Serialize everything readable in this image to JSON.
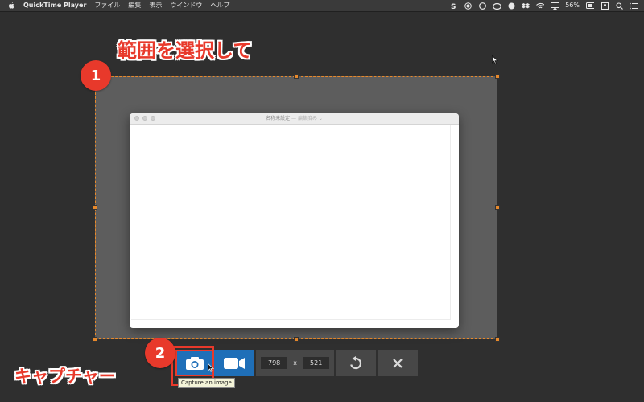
{
  "menubar": {
    "app_name": "QuickTime Player",
    "menus": [
      "ファイル",
      "編集",
      "表示",
      "ウインドウ",
      "ヘルプ"
    ],
    "battery": "56%"
  },
  "annotations": {
    "step1_number": "1",
    "step1_label": "範囲を選択して",
    "step2_number": "2",
    "step2_label": "キャプチャー"
  },
  "window": {
    "title": "名称未設定",
    "status": "— 編集済み ⌄"
  },
  "toolbar": {
    "width": "798",
    "times": "x",
    "height": "521",
    "tooltip": "Capture an image"
  },
  "colors": {
    "accent_orange": "#e8892b",
    "annotation_red": "#e8392b",
    "button_blue": "#1f6fb8"
  },
  "icons": {
    "capture": "camera-icon",
    "video": "video-camera-icon",
    "reset": "rotate-icon",
    "close": "close-icon"
  }
}
